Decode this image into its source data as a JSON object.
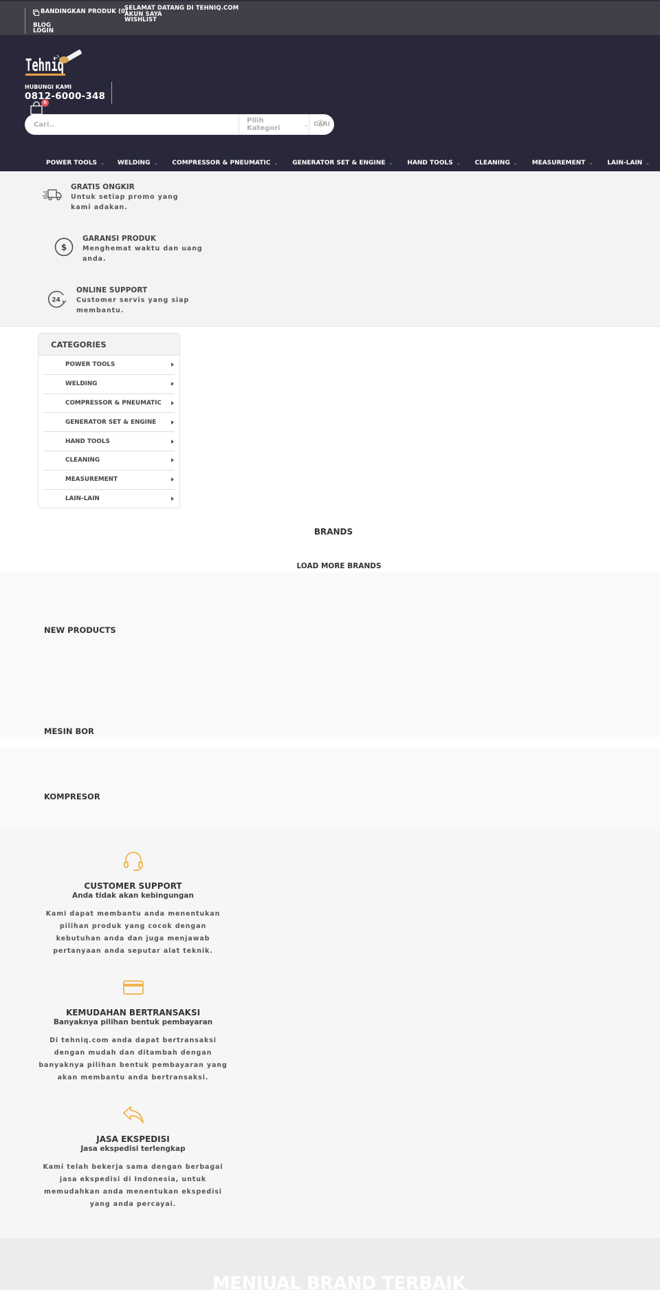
{
  "topbar": {
    "compare": "BANDINGKAN PRODUK (0)",
    "blog": "BLOG",
    "login": "LOGIN",
    "welcome": "SELAMAT DATANG DI TEHNIQ.COM",
    "account": "AKUN SAYA",
    "wishlist": "WISHLIST"
  },
  "header": {
    "logo_text": "Tehniq",
    "contact_label": "HUBUNGI KAMI",
    "phone": "0812-6000-348",
    "cart_count": "0",
    "search_placeholder": "Cari..",
    "category_select": "Pilih Kategori",
    "search_button": "CARI"
  },
  "nav": [
    {
      "label": "POWER TOOLS"
    },
    {
      "label": "WELDING"
    },
    {
      "label": "COMPRESSOR & PNEUMATIC"
    },
    {
      "label": "GENERATOR SET & ENGINE"
    },
    {
      "label": "HAND TOOLS"
    },
    {
      "label": "CLEANING"
    },
    {
      "label": "MEASUREMENT"
    },
    {
      "label": "LAIN-LAIN"
    }
  ],
  "features": [
    {
      "icon": "truck-icon",
      "title": "GRATIS ONGKIR",
      "desc": "Untuk setiap promo yang kami adakan."
    },
    {
      "icon": "dollar-circle-icon",
      "title": "GARANSI PRODUK",
      "desc": "Menghemat waktu dan uang anda."
    },
    {
      "icon": "24-hours-icon",
      "title": "ONLINE SUPPORT",
      "desc": "Customer servis yang siap membantu."
    }
  ],
  "categories": {
    "title": "CATEGORIES",
    "items": [
      "POWER TOOLS",
      "WELDING",
      "COMPRESSOR & PNEUMATIC",
      "GENERATOR SET & ENGINE",
      "HAND TOOLS",
      "CLEANING",
      "MEASUREMENT",
      "LAIN-LAIN"
    ]
  },
  "brands": {
    "title": "BRANDS",
    "load_more": "LOAD MORE BRANDS"
  },
  "sections": {
    "new_products": "NEW PRODUCTS",
    "mesin_bor": "MESIN BOR",
    "kompresor": "KOMPRESOR"
  },
  "services": [
    {
      "icon": "headset-icon",
      "title": "CUSTOMER SUPPORT",
      "subtitle": "Anda tidak akan kebingungan",
      "desc": "Kami dapat membantu anda menentukan pilihan produk yang cocok dengan kebutuhan anda dan juga menjawab pertanyaan anda seputar alat teknik."
    },
    {
      "icon": "credit-card-icon",
      "title": "KEMUDAHAN BERTRANSAKSI",
      "subtitle": "Banyaknya pilihan bentuk pembayaran",
      "desc": "Di tehniq.com anda dapat bertransaksi dengan mudah dan ditambah dengan banyaknya pilihan bentuk pembayaran yang akan membantu anda bertransaksi."
    },
    {
      "icon": "reply-arrow-icon",
      "title": "JASA EKSPEDISI",
      "subtitle": "Jasa ekspedisi terlengkap",
      "desc": "Kami telah bekerja sama dengan berbagai jasa ekspedisi di Indonesia, untuk memudahkan anda menentukan ekspedisi yang anda percayai."
    }
  ],
  "banner": {
    "title": "MENJUAL BRAND TERBAIK"
  },
  "colors": {
    "header_bg": "#28283a",
    "topbar_bg": "#414049",
    "accent": "#f0b34a",
    "badge": "#e05a5f"
  }
}
